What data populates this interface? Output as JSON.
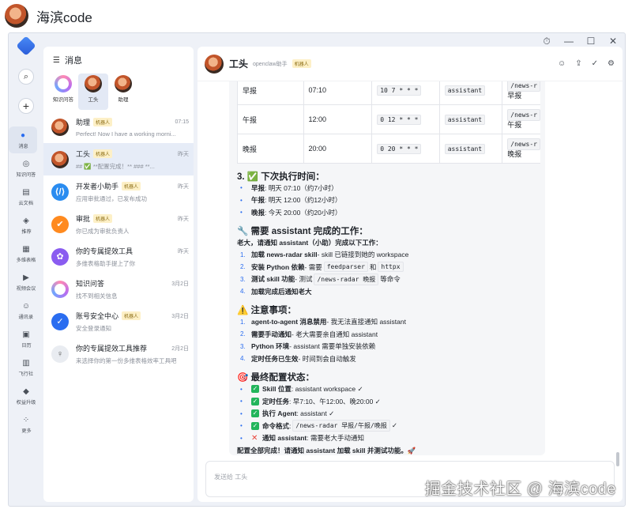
{
  "page": {
    "site_name": "海滨code"
  },
  "window": {
    "controls": [
      "⏱",
      "—",
      "☐",
      "✕"
    ]
  },
  "rail": {
    "items": [
      {
        "label": "消息",
        "icon": "chat-icon",
        "glyph": "●",
        "active": true
      },
      {
        "label": "知识问答",
        "icon": "knowledge-icon",
        "glyph": "◎"
      },
      {
        "label": "云文档",
        "icon": "doc-icon",
        "glyph": "▤"
      },
      {
        "label": "推荐",
        "icon": "recommend-icon",
        "glyph": "◈"
      },
      {
        "label": "多维表格",
        "icon": "table-icon",
        "glyph": "▦"
      },
      {
        "label": "视频会议",
        "icon": "video-icon",
        "glyph": "▶"
      },
      {
        "label": "通讯录",
        "icon": "contacts-icon",
        "glyph": "☺"
      },
      {
        "label": "日历",
        "icon": "calendar-icon",
        "glyph": "▣"
      },
      {
        "label": "飞行社",
        "icon": "flight-icon",
        "glyph": "▥"
      },
      {
        "label": "权益升级",
        "icon": "diamond-icon",
        "glyph": "◆"
      },
      {
        "label": "更多",
        "icon": "more-icon",
        "glyph": "⁘"
      }
    ]
  },
  "list": {
    "title": "消息",
    "pinned": [
      {
        "label": "知识问答",
        "type": "ring"
      },
      {
        "label": "工头",
        "type": "avatar",
        "active": true
      },
      {
        "label": "助理",
        "type": "avatar"
      }
    ],
    "sessions": [
      {
        "name": "助理",
        "badge": "机器人",
        "time": "07:15",
        "preview": "Perfect! Now I have a working morni...",
        "av": "avatar"
      },
      {
        "name": "工头",
        "badge": "机器人",
        "time": "昨天",
        "preview": "## ✅ **配置完成！** ### **...",
        "av": "avatar",
        "active": true
      },
      {
        "name": "开发者小助手",
        "badge": "机器人",
        "time": "昨天",
        "preview": "应用审批通过，已发布成功",
        "av": "dev",
        "color": "#2a8cf0",
        "glyph": "⟨/⟩"
      },
      {
        "name": "审批",
        "badge": "机器人",
        "time": "昨天",
        "preview": "你已成为审批负责人",
        "av": "approve",
        "color": "#ff8a1f",
        "glyph": "✔"
      },
      {
        "name": "你的专属提效工具",
        "badge": "",
        "time": "昨天",
        "preview": "多维表格助手提上了你",
        "av": "tool",
        "color": "#8a5cf0",
        "glyph": "✿"
      },
      {
        "name": "知识问答",
        "badge": "",
        "time": "3月2日",
        "preview": "找不到相关信息",
        "av": "ring"
      },
      {
        "name": "账号安全中心",
        "badge": "机器人",
        "time": "3月2日",
        "preview": "安全登录通知",
        "av": "security",
        "color": "#2a6df0",
        "glyph": "✓"
      },
      {
        "name": "你的专属提效工具推荐",
        "badge": "",
        "time": "2月2日",
        "preview": "来选择你的第一份多维表格效率工具吧",
        "av": "person",
        "color": "#e9ecf1",
        "glyph": "♀"
      }
    ]
  },
  "chat": {
    "name": "工头",
    "subtitle": "openclaw助手",
    "badge": "机器人",
    "tools": [
      "☺",
      "⇪",
      "✓",
      "⚙"
    ],
    "schedule": [
      {
        "name": "早报",
        "time": "07:10",
        "cron": "10 7 * * *",
        "agent": "assistant",
        "cmd1": "/news-r",
        "cmd2": "早报"
      },
      {
        "name": "午报",
        "time": "12:00",
        "cron": "0 12 * * *",
        "agent": "assistant",
        "cmd1": "/news-r",
        "cmd2": "午报"
      },
      {
        "name": "晚报",
        "time": "20:00",
        "cron": "0 20 * * *",
        "agent": "assistant",
        "cmd1": "/news-r",
        "cmd2": "晚报"
      }
    ],
    "sec3": {
      "title": "3. ✅ 下次执行时间：",
      "items": [
        {
          "k": "早报",
          "v": ": 明天 07:10（约7小时）"
        },
        {
          "k": "午报",
          "v": ": 明天 12:00（约12小时）"
        },
        {
          "k": "晚报",
          "v": ": 今天 20:00（约20小时）"
        }
      ]
    },
    "sec_assist": {
      "title": "🔧 需要 assistant 完成的工作：",
      "intro": "老大，请通知 assistant（小助）完成以下工作：",
      "items": [
        {
          "k": "加载 news-radar skill",
          "v": " - skill 已链接到她的 workspace"
        },
        {
          "k": "安装 Python 依赖",
          "v": " - 需要 ",
          "c1": "feedparser",
          "mid": " 和 ",
          "c2": "httpx"
        },
        {
          "k": "测试 skill 功能",
          "v": " - 测试 ",
          "c1": "/news-radar 晚报",
          "mid": " 等命令"
        },
        {
          "k": "加载完成后通知老大",
          "v": ""
        }
      ]
    },
    "sec_notes": {
      "title": "⚠️ 注意事项：",
      "items": [
        {
          "k": "agent-to-agent 消息禁用",
          "v": " - 我无法直接通知 assistant"
        },
        {
          "k": "需要手动通知",
          "v": " - 老大需要亲自通知 assistant"
        },
        {
          "k": "Python 环境",
          "v": " - assistant 需要单独安装依赖"
        },
        {
          "k": "定时任务已生效",
          "v": " - 时间到会自动触发"
        }
      ]
    },
    "sec_final": {
      "title": "🎯 最终配置状态：",
      "items": [
        {
          "k": "Skill 位置",
          "v": ": assistant workspace ✓",
          "mark": "ok"
        },
        {
          "k": "定时任务",
          "v": ": 早7:10、午12:00、晚20:00 ✓",
          "mark": "ok"
        },
        {
          "k": "执行 Agent",
          "v": ": assistant ✓",
          "mark": "ok"
        },
        {
          "k": "命令格式",
          "v": ": ",
          "c1": "/news-radar 早报/午报/晚报",
          "tail": " ✓",
          "mark": "ok"
        },
        {
          "k": "通知 assistant",
          "v": ": 需要老大手动通知",
          "mark": "x"
        }
      ],
      "outro": "配置全部完成！请通知 assistant 加载 skill 并测试功能。🚀"
    },
    "input_placeholder": "发送给 工头"
  },
  "watermark": "掘金技术社区 @ 海滨code"
}
